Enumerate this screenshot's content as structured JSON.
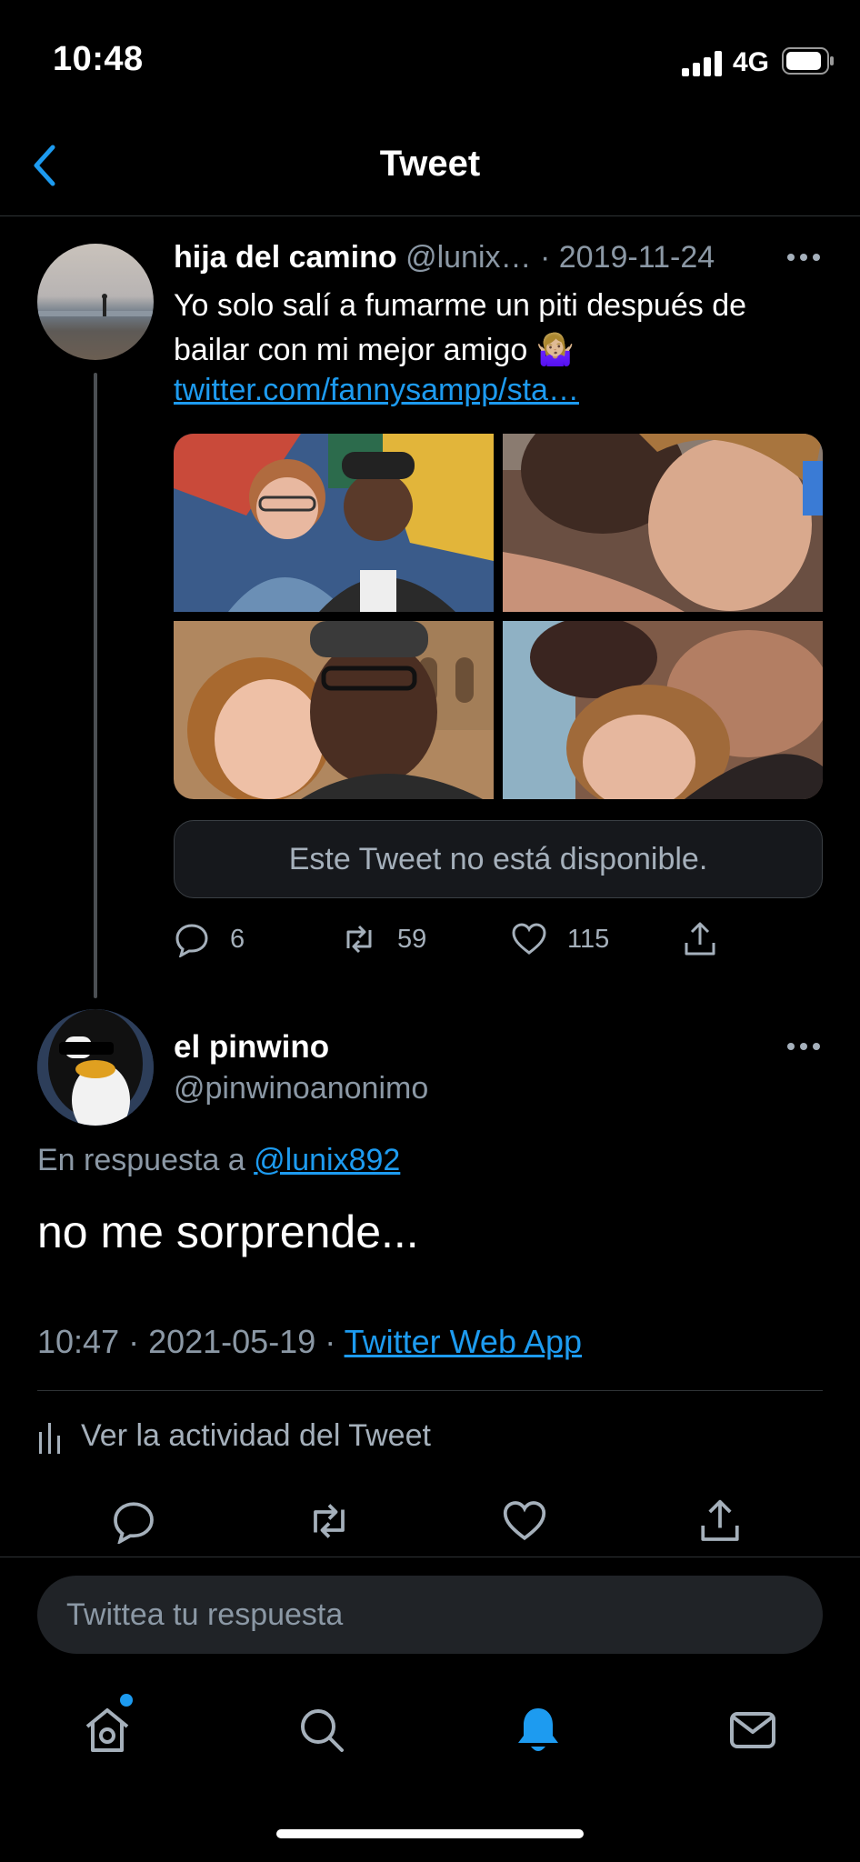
{
  "status_bar": {
    "time": "10:48",
    "network": "4G"
  },
  "header": {
    "title": "Tweet",
    "back_icon": "chevron-left-icon"
  },
  "quoted_tweet": {
    "display_name": "hija del camino",
    "handle": "@lunix…",
    "date": "· 2019-11-24",
    "text": "Yo solo salí a fumarme un piti después de bailar con mi mejor amigo 🤷🏼‍♀️",
    "link": "twitter.com/fannysampp/sta…",
    "unavailable_notice": "Este Tweet no está disponible.",
    "actions": {
      "replies": "6",
      "retweets": "59",
      "likes": "115"
    }
  },
  "reply_tweet": {
    "display_name": "el pinwino",
    "handle": "@pinwinoanonimo",
    "reply_to_prefix": "En respuesta a ",
    "reply_to_handle": "@lunix892",
    "text": "no me sorprende...",
    "timestamp": "10:47 · 2021-05-19 · ",
    "source": "Twitter Web App",
    "activity_label": "Ver la actividad del Tweet"
  },
  "compose": {
    "placeholder": "Twittea tu respuesta"
  },
  "bottom_nav": {
    "items": [
      "home-icon",
      "search-icon",
      "notifications-icon",
      "messages-icon"
    ],
    "active": "notifications-icon"
  },
  "colors": {
    "background": "#000000",
    "accent": "#1d9bf0",
    "secondary_text": "#8b98a5"
  }
}
